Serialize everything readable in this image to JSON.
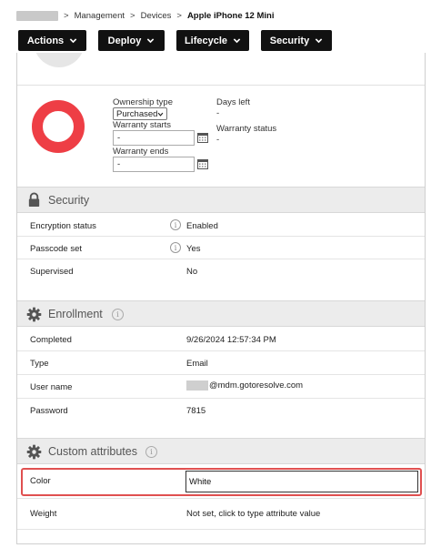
{
  "breadcrumb": {
    "items": [
      "Management",
      "Devices"
    ],
    "current": "Apple iPhone 12 Mini",
    "separator": ">"
  },
  "toolbar": {
    "actions_label": "Actions",
    "deploy_label": "Deploy",
    "lifecycle_label": "Lifecycle",
    "security_label": "Security"
  },
  "warranty": {
    "ownership_type_label": "Ownership type",
    "ownership_type_value": "Purchased",
    "warranty_starts_label": "Warranty starts",
    "warranty_starts_value": "-",
    "warranty_ends_label": "Warranty ends",
    "warranty_ends_value": "-",
    "days_left_label": "Days left",
    "days_left_value": "-",
    "warranty_status_label": "Warranty status",
    "warranty_status_value": "-"
  },
  "security": {
    "title": "Security",
    "rows": [
      {
        "label": "Encryption status",
        "value": "Enabled"
      },
      {
        "label": "Passcode set",
        "value": "Yes"
      },
      {
        "label": "Supervised",
        "value": "No"
      }
    ]
  },
  "enrollment": {
    "title": "Enrollment",
    "rows": [
      {
        "label": "Completed",
        "value": "9/26/2024 12:57:34 PM"
      },
      {
        "label": "Type",
        "value": "Email"
      },
      {
        "label": "User name",
        "value": "@mdm.gotoresolve.com"
      },
      {
        "label": "Password",
        "value": "7815"
      }
    ]
  },
  "custom_attributes": {
    "title": "Custom attributes",
    "rows": [
      {
        "label": "Color",
        "value": "White"
      },
      {
        "label": "Weight",
        "placeholder": "Not set, click to type attribute value"
      }
    ]
  },
  "colors": {
    "accent_ring": "#ee3e45",
    "highlight": "#e05050",
    "toolbar_bg": "#111111"
  },
  "icons": {
    "security": "lock-icon",
    "enrollment": "gear-icon",
    "custom_attributes": "gear-icon",
    "info": "info-icon",
    "calendar": "calendar-icon"
  }
}
